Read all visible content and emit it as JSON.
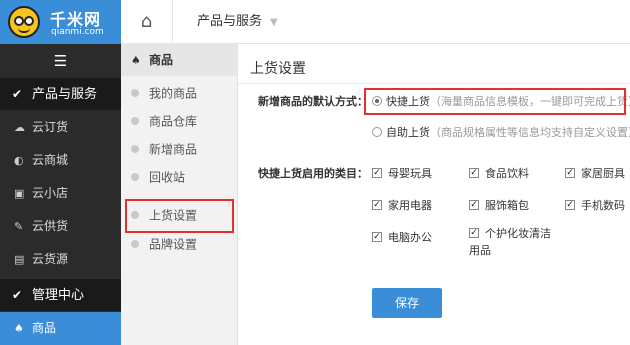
{
  "logo": {
    "name": "千米网",
    "sub": "qianmi.com"
  },
  "sidebar": {
    "menu_icon": "☰",
    "group1": {
      "label": "产品与服务"
    },
    "items": [
      {
        "label": "云订货",
        "icon": "cloud-order-icon"
      },
      {
        "label": "云商城",
        "icon": "cloud-mall-icon"
      },
      {
        "label": "云小店",
        "icon": "cloud-shop-icon"
      },
      {
        "label": "云供货",
        "icon": "cloud-supply-icon"
      },
      {
        "label": "云货源",
        "icon": "cloud-source-icon"
      }
    ],
    "group2": {
      "label": "管理中心"
    },
    "active_item": {
      "label": "商品",
      "icon": "goods-icon"
    }
  },
  "topbar": {
    "menu_label": "产品与服务"
  },
  "subnav": {
    "header": "商品",
    "items": [
      "我的商品",
      "商品仓库",
      "新增商品",
      "回收站",
      "上货设置",
      "品牌设置"
    ]
  },
  "main": {
    "title": "上货设置",
    "default_mode_label": "新增商品的默认方式：",
    "option_quick": "快捷上货",
    "option_quick_hint": "（海量商品信息模板，一键即可完成上货）",
    "option_auto": "自助上货",
    "option_auto_hint": "（商品规格属性等信息均支持自定义设置）",
    "categories_label": "快捷上货启用的类目：",
    "categories": [
      "母婴玩具",
      "食品饮料",
      "家居厨具",
      "家用电器",
      "服饰箱包",
      "手机数码",
      "电脑办公",
      "个护化妆清洁用品"
    ],
    "save_label": "保存"
  },
  "colors": {
    "accent": "#3a8ed8",
    "sidebar_bg": "#2b2b2b",
    "highlight": "#e03030"
  }
}
